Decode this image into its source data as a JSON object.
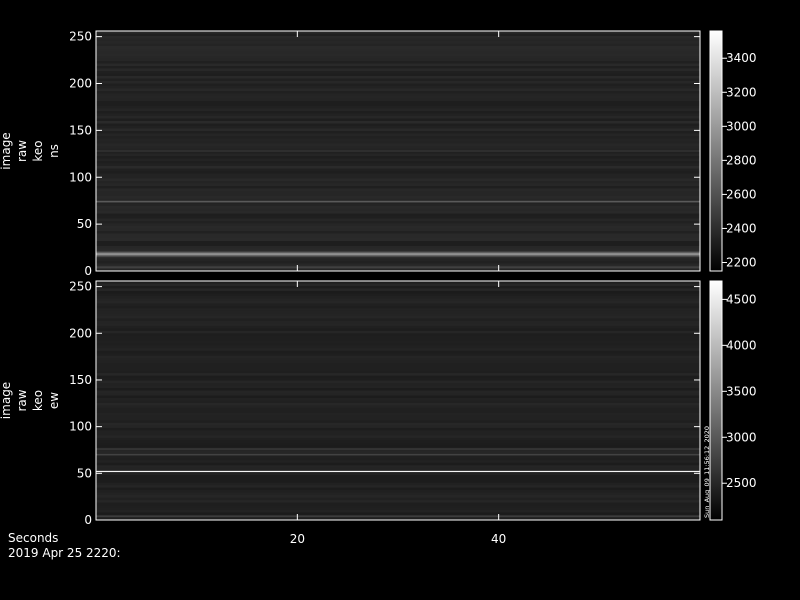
{
  "chart_data": [
    {
      "type": "heatmap",
      "ylabel_lines": [
        "image",
        "raw",
        "keo",
        "ns"
      ],
      "x_range": [
        0,
        60
      ],
      "ylim": [
        0,
        256
      ],
      "yticks": [
        0,
        50,
        100,
        150,
        200,
        250
      ],
      "colorbar": {
        "range": [
          2150,
          3560
        ],
        "ticks": [
          2200,
          2400,
          2600,
          2800,
          3000,
          3200,
          3400
        ]
      },
      "base_level": 0.14,
      "bright_rows": [
        {
          "y": 18,
          "width": 5,
          "intensity": 0.42
        },
        {
          "y": 74,
          "width": 2,
          "intensity": 0.22
        },
        {
          "y": 128,
          "width": 1.2,
          "intensity": 0.08
        },
        {
          "y": 4,
          "width": 3,
          "intensity": 0.12
        }
      ],
      "stamp": ""
    },
    {
      "type": "heatmap",
      "ylabel_lines": [
        "image",
        "raw",
        "keo",
        "ew"
      ],
      "x_range": [
        0,
        60
      ],
      "ylim": [
        0,
        256
      ],
      "yticks": [
        0,
        50,
        100,
        150,
        200,
        250
      ],
      "colorbar": {
        "range": [
          2100,
          4700
        ],
        "ticks": [
          2500,
          3000,
          3500,
          4000,
          4500
        ]
      },
      "base_level": 0.13,
      "bright_rows": [
        {
          "y": 52,
          "width": 1.2,
          "intensity": 0.85
        },
        {
          "y": 70,
          "width": 2,
          "intensity": 0.14
        },
        {
          "y": 76,
          "width": 2,
          "intensity": 0.1
        },
        {
          "y": 4,
          "width": 2,
          "intensity": 0.12
        }
      ],
      "stamp": "Sun_Aug_09_11:56:12_2020"
    }
  ],
  "xaxis": {
    "label": "Seconds",
    "ticks": [
      20,
      40
    ]
  },
  "footer": {
    "date_label": "2019 Apr 25 2220:"
  }
}
